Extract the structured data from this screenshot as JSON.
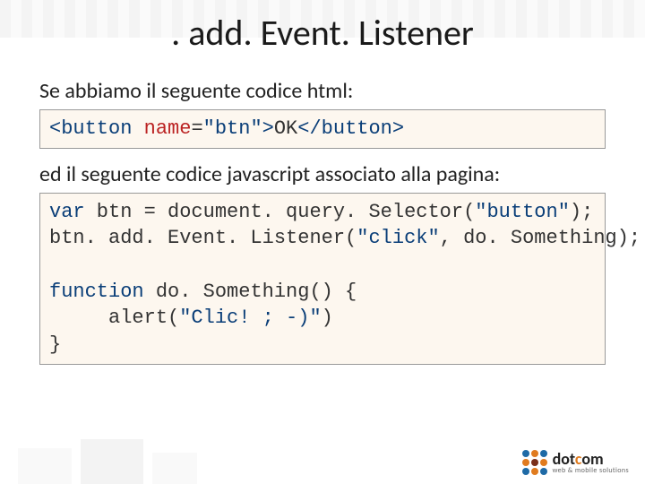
{
  "title": ". add. Event. Listener",
  "intro1": "Se abbiamo il seguente codice html:",
  "intro2": "ed il seguente codice javascript associato alla pagina:",
  "code1": {
    "open_tag": "<button",
    "attr_name": " name",
    "eq": "=",
    "attr_val": "\"btn\"",
    "close_open": ">",
    "text": "OK",
    "close_tag": "</button>"
  },
  "code2": {
    "l1a": "var",
    "l1b": " btn = document. query. Selector(",
    "l1c": "\"button\"",
    "l1d": ");",
    "l2a": "btn. add. Event. Listener(",
    "l2b": "\"click\"",
    "l2c": ", do. Something);",
    "blank": "",
    "l3a": "function",
    "l3b": " do. Something() {",
    "l4a": "     alert(",
    "l4b": "\"Clic! ; -)\"",
    "l4c": ")",
    "l5": "}"
  },
  "logo": {
    "brand_a": "dot",
    "brand_b": "c",
    "brand_c": "om",
    "sub": "web & mobile solutions"
  }
}
